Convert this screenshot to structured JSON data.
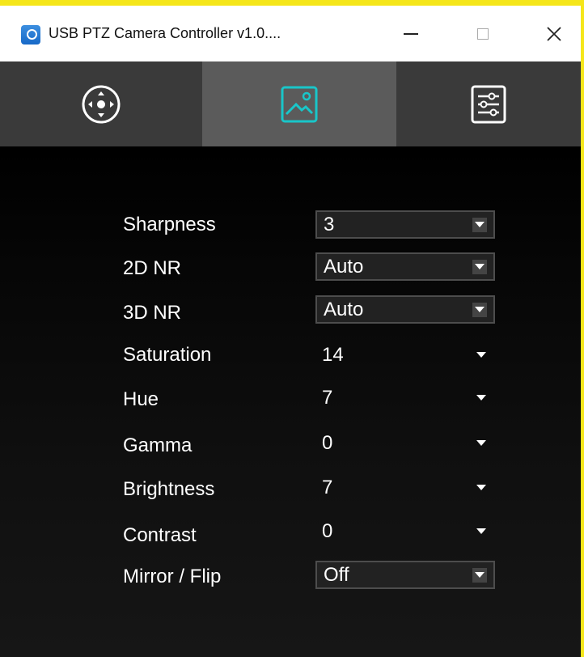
{
  "window": {
    "title": "USB PTZ Camera Controller v1.0...."
  },
  "controls": [
    {
      "label": "Sharpness",
      "value": "3"
    },
    {
      "label": "2D NR",
      "value": "Auto"
    },
    {
      "label": "3D NR",
      "value": "Auto"
    },
    {
      "label": "Saturation",
      "value": "14"
    },
    {
      "label": "Hue",
      "value": "7"
    },
    {
      "label": "Gamma",
      "value": "0"
    },
    {
      "label": "Brightness",
      "value": "7"
    },
    {
      "label": "Contrast",
      "value": "0"
    },
    {
      "label": "Mirror / Flip",
      "value": "Off"
    }
  ],
  "tabs": [
    {
      "icon": "joystick-icon",
      "active": false
    },
    {
      "icon": "image-icon",
      "active": true
    },
    {
      "icon": "sliders-icon",
      "active": false
    }
  ],
  "colors": {
    "accent": "#19c6c9",
    "tab_bar": "#3a3a3a",
    "active_tab": "#5b5b5b"
  }
}
